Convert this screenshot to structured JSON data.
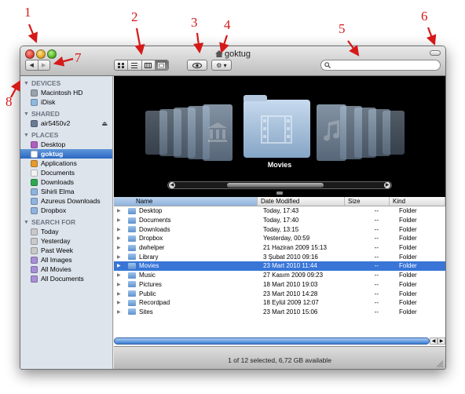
{
  "window": {
    "title": "goktug"
  },
  "toolbar": {
    "back_label": "◀",
    "forward_label": "▶",
    "view_modes": [
      "icon",
      "list",
      "column",
      "coverflow"
    ],
    "selected_view": "coverflow",
    "quicklook_label": "👁",
    "action_label": "⚙ ▾",
    "search_placeholder": ""
  },
  "sidebar": {
    "sections": [
      {
        "title": "DEVICES",
        "items": [
          {
            "label": "Macintosh HD",
            "icon": "hard-disk-icon",
            "color": "#9aa3ad"
          },
          {
            "label": "iDisk",
            "icon": "idisk-icon",
            "color": "#8fb8e0"
          }
        ]
      },
      {
        "title": "SHARED",
        "items": [
          {
            "label": "air5450v2",
            "icon": "network-computer-icon",
            "color": "#6b7b94",
            "eject": "⏏"
          }
        ]
      },
      {
        "title": "PLACES",
        "items": [
          {
            "label": "Desktop",
            "icon": "desktop-icon",
            "color": "#b05fbf"
          },
          {
            "label": "goktug",
            "icon": "home-icon",
            "color": "#ffffff",
            "selected": true
          },
          {
            "label": "Applications",
            "icon": "applications-icon",
            "color": "#e69a2d"
          },
          {
            "label": "Documents",
            "icon": "documents-icon",
            "color": "#f2f2f2"
          },
          {
            "label": "Downloads",
            "icon": "downloads-icon",
            "color": "#2fa84f"
          },
          {
            "label": "Sihirli Elma",
            "icon": "folder-icon",
            "color": "#8fb3dc"
          },
          {
            "label": "Azureus Downloads",
            "icon": "folder-icon",
            "color": "#8fb3dc"
          },
          {
            "label": "Dropbox",
            "icon": "folder-icon",
            "color": "#8fb3dc"
          }
        ]
      },
      {
        "title": "SEARCH FOR",
        "items": [
          {
            "label": "Today",
            "icon": "clock-icon",
            "color": "#c9c9c9"
          },
          {
            "label": "Yesterday",
            "icon": "clock-icon",
            "color": "#c9c9c9"
          },
          {
            "label": "Past Week",
            "icon": "clock-icon",
            "color": "#c9c9c9"
          },
          {
            "label": "All Images",
            "icon": "smart-folder-icon",
            "color": "#a98fd6"
          },
          {
            "label": "All Movies",
            "icon": "smart-folder-icon",
            "color": "#a98fd6"
          },
          {
            "label": "All Documents",
            "icon": "smart-folder-icon",
            "color": "#a98fd6"
          }
        ]
      }
    ]
  },
  "coverflow": {
    "current_label": "Movies",
    "left_arrow": "◀",
    "right_arrow": "▶"
  },
  "list": {
    "columns": {
      "name": "Name",
      "date": "Date Modified",
      "size": "Size",
      "kind": "Kind"
    },
    "rows": [
      {
        "name": "Desktop",
        "date": "Today, 17:43",
        "size": "--",
        "kind": "Folder"
      },
      {
        "name": "Documents",
        "date": "Today, 17:40",
        "size": "--",
        "kind": "Folder"
      },
      {
        "name": "Downloads",
        "date": "Today, 13:15",
        "size": "--",
        "kind": "Folder"
      },
      {
        "name": "Dropbox",
        "date": "Yesterday, 00:59",
        "size": "--",
        "kind": "Folder"
      },
      {
        "name": "dwhelper",
        "date": "21 Haziran 2009 15:13",
        "size": "--",
        "kind": "Folder"
      },
      {
        "name": "Library",
        "date": "3 Şubat 2010 09:16",
        "size": "--",
        "kind": "Folder"
      },
      {
        "name": "Movies",
        "date": "23 Mart 2010 11:44",
        "size": "--",
        "kind": "Folder",
        "selected": true
      },
      {
        "name": "Music",
        "date": "27 Kasım 2009 09:23",
        "size": "--",
        "kind": "Folder"
      },
      {
        "name": "Pictures",
        "date": "18 Mart 2010 19:03",
        "size": "--",
        "kind": "Folder"
      },
      {
        "name": "Public",
        "date": "23 Mart 2010 14:28",
        "size": "--",
        "kind": "Folder"
      },
      {
        "name": "Recordpad",
        "date": "18 Eylül 2009 12:07",
        "size": "--",
        "kind": "Folder"
      },
      {
        "name": "Sites",
        "date": "23 Mart 2010 15:06",
        "size": "--",
        "kind": "Folder"
      }
    ]
  },
  "status": {
    "text": "1 of 12 selected, 6,72 GB available"
  },
  "callouts": [
    "1",
    "2",
    "3",
    "4",
    "5",
    "6",
    "7",
    "8"
  ],
  "colors": {
    "callout": "#d51919",
    "selection": "#3875d7",
    "sidebar_bg": "#dde4ec"
  }
}
